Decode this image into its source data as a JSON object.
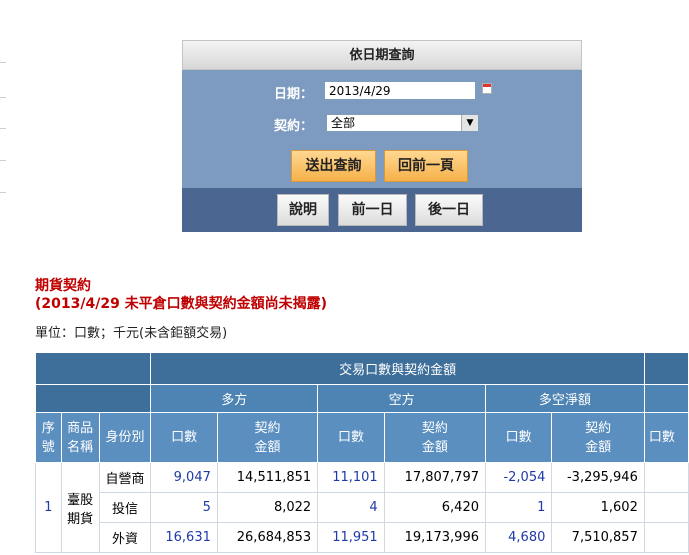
{
  "query_panel": {
    "title": "依日期查詢",
    "date_label": "日期：",
    "date_value": "2013/4/29",
    "contract_label": "契約：",
    "contract_value": "全部",
    "submit_label": "送出查詢",
    "back_label": "回前一頁",
    "help_label": "說明",
    "prev_label": "前一日",
    "next_label": "後一日"
  },
  "section": {
    "title": "期貨契約",
    "subtitle": "(2013/4/29 未平倉口數與契約金額尚未揭露)",
    "unit": "單位：口數；千元(未含鉅額交易)"
  },
  "table": {
    "group_header": "交易口數與契約金額",
    "long": "多方",
    "short": "空方",
    "net": "多空淨額",
    "col_seq": [
      "序",
      "號"
    ],
    "col_product": [
      "商品",
      "名稱"
    ],
    "col_identity": "身份別",
    "col_qty": "口數",
    "col_amount": [
      "契約",
      "金額"
    ],
    "col_qty_cut": "口數",
    "seq": "1",
    "product": [
      "臺股",
      "期貨"
    ],
    "rows": [
      {
        "identity": "自營商",
        "long_qty": "9,047",
        "long_amt": "14,511,851",
        "short_qty": "11,101",
        "short_amt": "17,807,797",
        "net_qty": "-2,054",
        "net_amt": "-3,295,946"
      },
      {
        "identity": "投信",
        "long_qty": "5",
        "long_amt": "8,022",
        "short_qty": "4",
        "short_amt": "6,420",
        "net_qty": "1",
        "net_amt": "1,602"
      },
      {
        "identity": "外資",
        "long_qty": "16,631",
        "long_amt": "26,684,853",
        "short_qty": "11,951",
        "short_amt": "19,173,996",
        "net_qty": "4,680",
        "net_amt": "7,510,857"
      }
    ]
  },
  "colors": {
    "heading": "#c00000",
    "table_header": "#3e6f9a",
    "panel": "#7d9bc0",
    "panel_footer": "#4b6690",
    "button_orange": "#f6b14a",
    "link_blue": "#1f3aa8"
  }
}
